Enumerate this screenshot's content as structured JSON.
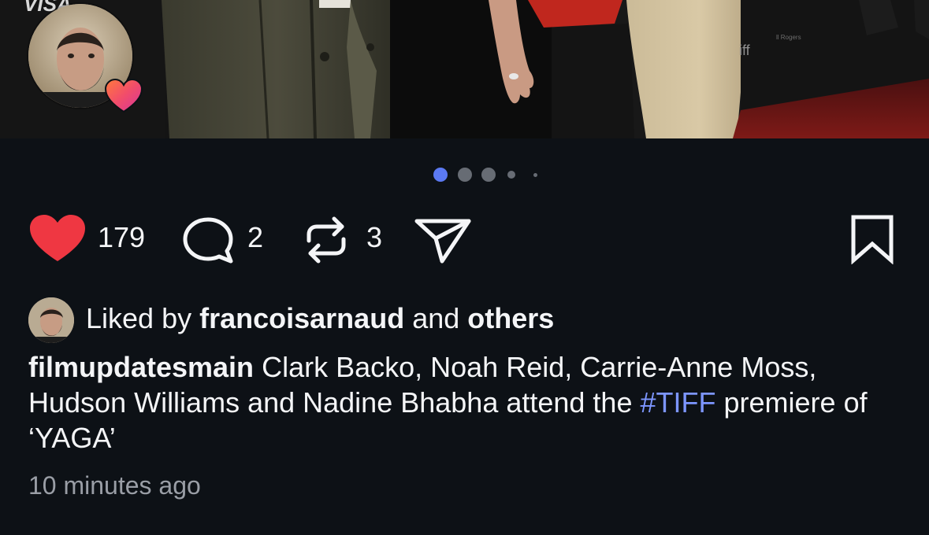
{
  "post": {
    "carousel": {
      "total_slides": 5,
      "active_slide": 1
    },
    "actions": {
      "like_count": "179",
      "comment_count": "2",
      "repost_count": "3"
    },
    "likes": {
      "prefix": "Liked by",
      "user": "francoisarnaud",
      "joiner": "and",
      "others": "others"
    },
    "caption": {
      "username": "filmupdatesmain",
      "text": "Clark Backo, Noah Reid, Carrie-Anne Moss, Hudson Williams and Nadine Bhabha attend the",
      "hashtag": "#TIFF",
      "text_after": "premiere of ‘YAGA’"
    },
    "timestamp": "10 minutes ago",
    "colors": {
      "background": "#0d1116",
      "like_red": "#ef3742",
      "accent_blue": "#5b79f2",
      "hashtag_blue": "#7d96ff",
      "muted_text": "#9a9ea6"
    },
    "icons": {
      "like": "heart-filled-icon",
      "comment": "comment-bubble-icon",
      "repost": "repost-arrows-icon",
      "share": "paper-plane-icon",
      "save": "bookmark-icon"
    }
  }
}
